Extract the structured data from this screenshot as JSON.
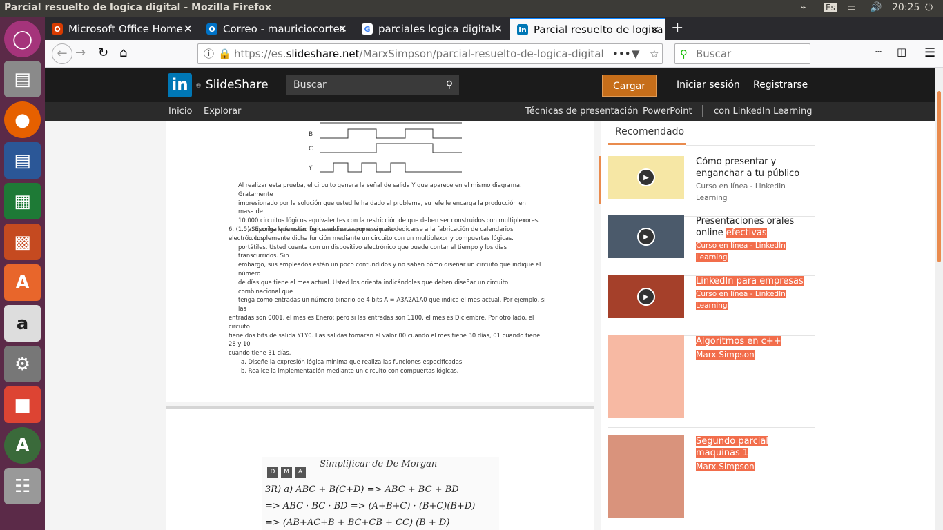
{
  "window": {
    "title": "Parcial resuelto de logica digital - Mozilla Firefox",
    "lang": "Es",
    "time": "20:25"
  },
  "tabs": [
    {
      "label": "Microsoft Office Home",
      "favicon": "office-icon",
      "color": "#d83b01"
    },
    {
      "label": "Correo - mauriciocortes",
      "favicon": "outlook-icon",
      "color": "#0072c6"
    },
    {
      "label": "parciales logica digital -",
      "favicon": "google-icon",
      "color": "#4285f4"
    },
    {
      "label": "Parcial resuelto de logica",
      "favicon": "linkedin-icon",
      "color": "#0077b5"
    }
  ],
  "url": {
    "prefix": "https://es.",
    "domain": "slideshare.net",
    "path": "/MarxSimpson/parcial-resuelto-de-logica-digital"
  },
  "search_placeholder": "Buscar",
  "slideshare": {
    "brand": "SlideShare",
    "search_placeholder": "Buscar",
    "upload": "Cargar",
    "login": "Iniciar sesión",
    "register": "Registrarse",
    "nav_left": [
      "Inicio",
      "Explorar"
    ],
    "nav_right": [
      "Técnicas de presentación",
      "PowerPoint",
      "con LinkedIn Learning"
    ]
  },
  "doc": {
    "signals": [
      "B",
      "C",
      "Y"
    ],
    "para1": [
      "Al realizar esta prueba, el circuito genera la señal de salida Y que aparece en el mismo diagrama. Gratamente",
      "impresionado por la solución que usted le ha dado al problema, su jefe le encarga la producción en masa de",
      "10.000 circuitos lógicos equivalentes con la restricción de que deben ser construidos con multiplexores."
    ],
    "items1": [
      "a.    Escriba la función lógica realizada por el circuito.",
      "b.    Implemente dicha función mediante un circuito con un multiplexor y compuertas lógicas."
    ],
    "q6": [
      "6.    (1.5) Suponga que usted ha creado una empresa para dedicarse a la fabricación de calendarios electrónicos",
      "portátiles. Usted cuenta con un dispositivo electrónico que puede contar el tiempo y los días transcurridos. Sin",
      "embargo, sus empleados están un poco confundidos y no saben cómo diseñar un circuito que indique el número",
      "de días que tiene el mes actual.  Usted los orienta indicándoles que deben diseñar un circuito combinacional que",
      "tenga como entradas un número binario de 4 bits A = A3A2A1A0 que indica el mes actual. Por ejemplo, si las",
      "entradas son 0001, el mes es Enero; pero si las entradas son 1100, el mes es Diciembre. Por otro lado, el circuito",
      "tiene dos bits de salida Y1Y0. Las salidas tomaran el valor 00 cuando el mes tiene 30 días, 01 cuando tiene 28 y 10",
      "cuando tiene 31 días."
    ],
    "items2": [
      "a.    Diseñe la expresión lógica mínima que realiza las funciones especificadas.",
      "b.    Realice la implementación mediante un circuito con compuertas lógicas."
    ],
    "hand_title": "Simplificar  de  De  Morgan",
    "hand_lines": [
      "3R) a)  ABC + B(C+D)   =>  ABC + BC + BD",
      "=> ABC · BC · BD  =>  (A+B+C) · (B+C)(B+D)",
      "=> (AB+AC+B + BC+CB + CC) (B + D)"
    ],
    "dma": [
      "D",
      "M",
      "A"
    ]
  },
  "sidebar": {
    "heading": "Recomendado",
    "items": [
      {
        "title": "Cómo presentar y enganchar a tu público",
        "sub": "Curso en línea - LinkedIn Learning",
        "thumb_color": "#f6e7a5",
        "video": true
      },
      {
        "title_plain": "Presentaciones orales online ",
        "title_hl": "efectivas",
        "sub": "Curso en línea - LinkedIn Learning",
        "thumb_color": "#4b5a6b",
        "video": true
      },
      {
        "title_hl": "LinkedIn para empresas",
        "sub": "Curso en línea - LinkedIn Learning",
        "thumb_color": "#a5402a",
        "video": true
      },
      {
        "title_hl": "Algoritmos en c++",
        "sub": "Marx Simpson",
        "thumb_color": "#f7b9a3",
        "video": false
      },
      {
        "title_hl": "Segundo parcial maquinas 1",
        "sub": "Marx Simpson",
        "thumb_color": "#d9937c",
        "video": false
      }
    ]
  }
}
